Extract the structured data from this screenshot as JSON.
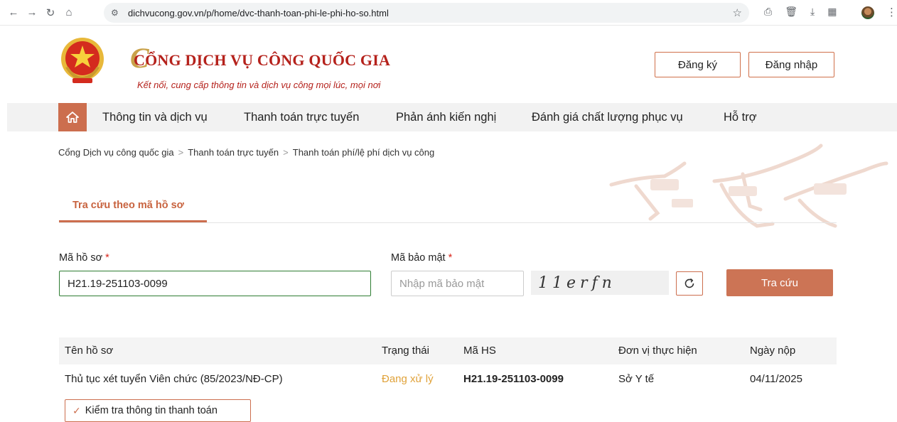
{
  "browser": {
    "url": "dichvucong.gov.vn/p/home/dvc-thanh-toan-phi-le-phi-ho-so.html"
  },
  "header": {
    "title": "CỔNG DỊCH VỤ CÔNG QUỐC GIA",
    "subtitle": "Kết nối, cung cấp thông tin và dịch vụ công mọi lúc, mọi nơi",
    "register_label": "Đăng ký",
    "login_label": "Đăng nhập"
  },
  "nav": {
    "items": [
      {
        "label": "Thông tin và dịch vụ"
      },
      {
        "label": "Thanh toán trực tuyến"
      },
      {
        "label": "Phản ánh kiến nghị"
      },
      {
        "label": "Đánh giá chất lượng phục vụ"
      },
      {
        "label": "Hỗ trợ"
      }
    ]
  },
  "breadcrumb": [
    "Cổng Dịch vụ công quốc gia",
    "Thanh toán trực tuyến",
    "Thanh toán phí/lệ phí dịch vụ công"
  ],
  "tab": {
    "label": "Tra cứu theo mã hồ sơ"
  },
  "form": {
    "record_label": "Mã hồ sơ",
    "record_value": "H21.19-251103-0099",
    "captcha_label": "Mã bảo mật",
    "captcha_placeholder": "Nhập mã bảo mật",
    "captcha_code": "11erfn",
    "search_label": "Tra cứu",
    "required_mark": "*"
  },
  "results": {
    "columns": [
      "Tên hồ sơ",
      "Trạng thái",
      "Mã HS",
      "Đơn vị thực hiện",
      "Ngày nộp"
    ],
    "rows": [
      {
        "name": "Thủ tục xét tuyển Viên chức (85/2023/NĐ-CP)",
        "status": "Đang xử lý",
        "code": "H21.19-251103-0099",
        "unit": "Sở Y tế",
        "date": "04/11/2025"
      }
    ],
    "check_button_label": "Kiểm tra thông tin thanh toán"
  },
  "colors": {
    "accent": "#cc6e4e",
    "brand_red": "#b5221c",
    "status_processing": "#e0a23a"
  }
}
